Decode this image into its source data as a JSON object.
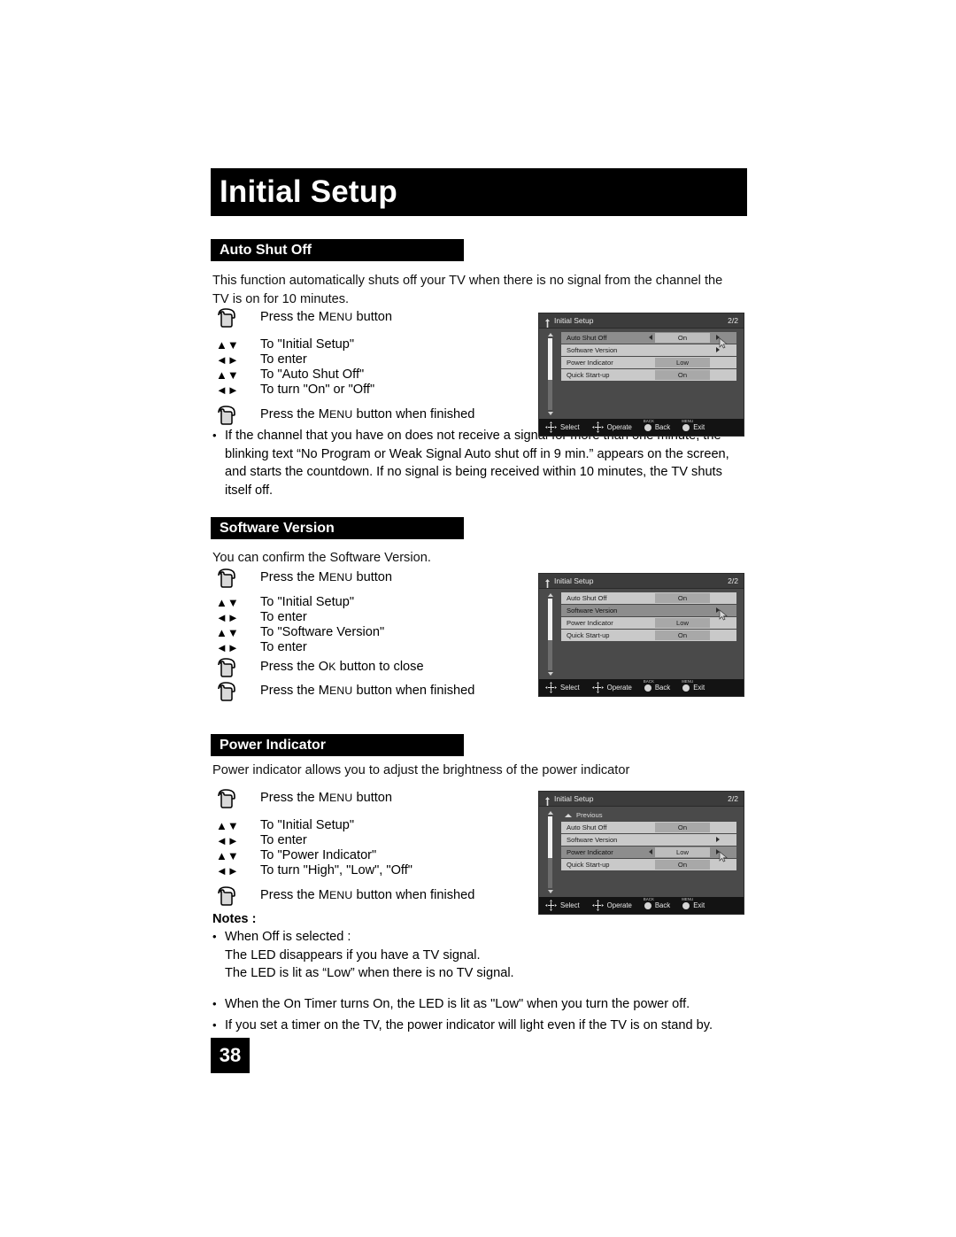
{
  "page": {
    "title": "Initial Setup",
    "number": "38"
  },
  "sections": [
    {
      "heading": "Auto Shut Off",
      "intro": "This function automatically shuts off your TV when there is no signal from the channel the TV is on for 10 minutes.",
      "steps": [
        {
          "icon": "hand",
          "pre": "Press the ",
          "sc_first": "M",
          "sc_rest": "ENU",
          "post": " button"
        },
        {
          "icon": "updown",
          "label": "To \"Initial Setup\""
        },
        {
          "icon": "leftright",
          "label": "To enter"
        },
        {
          "icon": "updown",
          "label": "To \"Auto Shut Off\""
        },
        {
          "icon": "leftright",
          "label": "To turn \"On\" or \"Off\""
        },
        {
          "icon": "hand",
          "pre": "Press the ",
          "sc_first": "M",
          "sc_rest": "ENU",
          "post": " button when finished"
        }
      ],
      "bullets": [
        "If the channel that you have on does not receive a signal for more than one minute, the blinking text “No Program or Weak Signal Auto shut off in 9 min.” appears on the screen, and starts the countdown. If no signal is being received within 10 minutes, the TV shuts itself off."
      ]
    },
    {
      "heading": "Software Version",
      "intro": "You can confirm the Software Version.",
      "steps": [
        {
          "icon": "hand",
          "pre": "Press the ",
          "sc_first": "M",
          "sc_rest": "ENU",
          "post": " button"
        },
        {
          "icon": "updown",
          "label": "To \"Initial Setup\""
        },
        {
          "icon": "leftright",
          "label": "To enter"
        },
        {
          "icon": "updown",
          "label": "To \"Software Version\""
        },
        {
          "icon": "leftright",
          "label": "To enter"
        },
        {
          "icon": "hand",
          "pre": "Press the ",
          "sc_first": "O",
          "sc_rest": "K",
          "post": " button to close"
        },
        {
          "icon": "hand",
          "pre": "Press the ",
          "sc_first": "M",
          "sc_rest": "ENU",
          "post": " button when finished"
        }
      ]
    },
    {
      "heading": "Power Indicator",
      "intro": "Power indicator allows you to adjust the brightness of the power indicator",
      "steps": [
        {
          "icon": "hand",
          "pre": "Press the ",
          "sc_first": "M",
          "sc_rest": "ENU",
          "post": " button"
        },
        {
          "icon": "updown",
          "label": "To \"Initial Setup\""
        },
        {
          "icon": "leftright",
          "label": "To enter"
        },
        {
          "icon": "updown",
          "label": "To \"Power Indicator\""
        },
        {
          "icon": "leftright",
          "label": "To turn \"High\", \"Low\", \"Off\""
        },
        {
          "icon": "hand",
          "pre": "Press the ",
          "sc_first": "M",
          "sc_rest": "ENU",
          "post": " button when finished"
        }
      ]
    }
  ],
  "notes": {
    "title": "Notes :",
    "items": [
      "When Off is selected :\nThe LED disappears if you have a TV signal.\nThe LED is lit as “Low” when there is no TV signal.",
      "When the On Timer turns On, the LED is lit as \"Low\" when you turn the power off.",
      "If you set a timer on the TV, the power indicator will light even if the TV is on stand by."
    ]
  },
  "osd": {
    "title": "Initial Setup",
    "page_indicator": "2/2",
    "previous_label": "Previous",
    "footer": [
      {
        "icon": "dpad",
        "label": "Select"
      },
      {
        "icon": "dpad",
        "label": "Operate"
      },
      {
        "icon": "button",
        "cap": "BACK",
        "label": "Back"
      },
      {
        "icon": "button",
        "cap": "MENU",
        "label": "Exit"
      }
    ],
    "screens": [
      {
        "id": "auto-shut-off",
        "has_previous": false,
        "rows": [
          {
            "label": "Auto Shut Off",
            "value": "On",
            "selected": true,
            "type": "value"
          },
          {
            "label": "Software Version",
            "value": "",
            "selected": false,
            "type": "submenu"
          },
          {
            "label": "Power Indicator",
            "value": "Low",
            "selected": false,
            "type": "value"
          },
          {
            "label": "Quick Start-up",
            "value": "On",
            "selected": false,
            "type": "value"
          }
        ]
      },
      {
        "id": "software-version",
        "has_previous": false,
        "rows": [
          {
            "label": "Auto Shut Off",
            "value": "On",
            "selected": false,
            "type": "value"
          },
          {
            "label": "Software Version",
            "value": "",
            "selected": true,
            "type": "submenu"
          },
          {
            "label": "Power Indicator",
            "value": "Low",
            "selected": false,
            "type": "value"
          },
          {
            "label": "Quick Start-up",
            "value": "On",
            "selected": false,
            "type": "value"
          }
        ]
      },
      {
        "id": "power-indicator",
        "has_previous": true,
        "rows": [
          {
            "label": "Auto Shut Off",
            "value": "On",
            "selected": false,
            "type": "value"
          },
          {
            "label": "Software Version",
            "value": "",
            "selected": false,
            "type": "submenu"
          },
          {
            "label": "Power Indicator",
            "value": "Low",
            "selected": true,
            "type": "value"
          },
          {
            "label": "Quick Start-up",
            "value": "On",
            "selected": false,
            "type": "value"
          }
        ]
      }
    ]
  },
  "colors": {
    "bar_bg": "#000000",
    "bar_text": "#ffffff",
    "osd_bg": "#4a4a4a",
    "osd_row": "#c9c9c9",
    "osd_row_selected": "#8d8d8d",
    "osd_footer": "#131313"
  }
}
